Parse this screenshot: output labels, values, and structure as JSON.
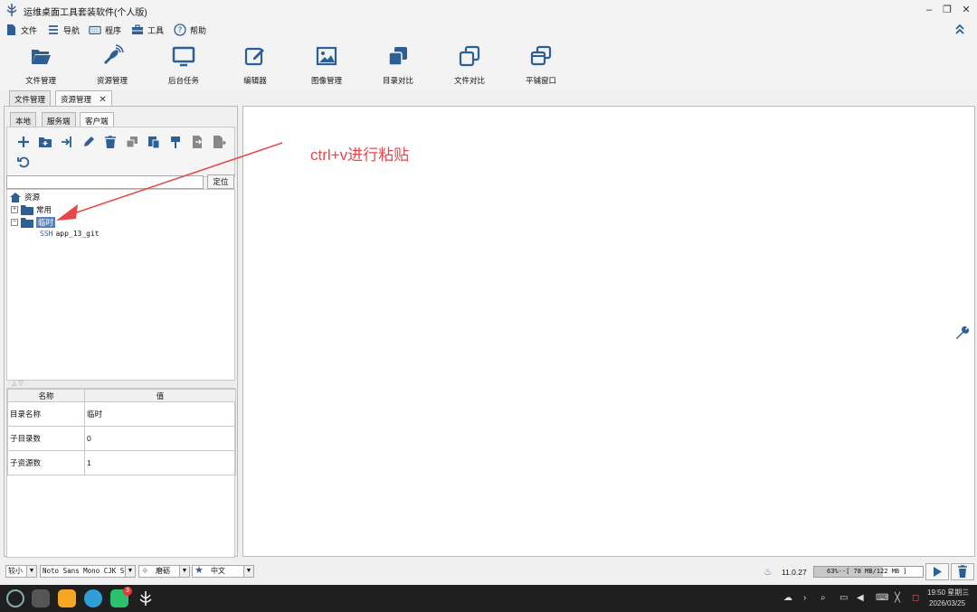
{
  "window": {
    "title": "运维桌面工具套装软件(个人版)"
  },
  "menu": [
    {
      "label": "文件",
      "icon": "file-icon"
    },
    {
      "label": "导航",
      "icon": "menu-icon"
    },
    {
      "label": "程序",
      "icon": "keyboard-icon"
    },
    {
      "label": "工具",
      "icon": "toolbox-icon"
    },
    {
      "label": "帮助",
      "icon": "help-icon"
    }
  ],
  "toolbar": [
    {
      "label": "文件管理",
      "icon": "folder-open-icon"
    },
    {
      "label": "资源管理",
      "icon": "satellite-icon"
    },
    {
      "label": "后台任务",
      "icon": "monitor-icon"
    },
    {
      "label": "编辑器",
      "icon": "edit-icon"
    },
    {
      "label": "图像管理",
      "icon": "image-icon"
    },
    {
      "label": "目录对比",
      "icon": "stack-icon"
    },
    {
      "label": "文件对比",
      "icon": "copy-icon"
    },
    {
      "label": "平铺窗口",
      "icon": "windows-icon"
    }
  ],
  "tabs": [
    {
      "label": "文件管理"
    },
    {
      "label": "资源管理",
      "close": "✕"
    }
  ],
  "subtabs": [
    {
      "label": "本地"
    },
    {
      "label": "服务端"
    },
    {
      "label": "客户端"
    }
  ],
  "locate": {
    "value": "",
    "button": "定位"
  },
  "tree": {
    "root": "资源",
    "nodes": [
      {
        "label": "常用",
        "expander": "+"
      },
      {
        "label": "临时",
        "expander": "−"
      }
    ],
    "leaf": {
      "badge": "SSH",
      "label": "app_13_git"
    }
  },
  "properties": {
    "headers": [
      "名称",
      "值"
    ],
    "rows": [
      {
        "name": "目录名称",
        "value": "临时"
      },
      {
        "name": "子目录数",
        "value": "0"
      },
      {
        "name": "子资源数",
        "value": "1"
      }
    ]
  },
  "annotation": {
    "text": "ctrl+v进行粘贴",
    "color": "#e8474a"
  },
  "status": {
    "size_select": "较小",
    "font_select": "Noto Sans Mono CJK SC",
    "theme_select": "磨砺",
    "lang_select": "中文",
    "java_version": "11.0.27",
    "memory": "63%--[ 78 MB/122 MB ]"
  },
  "taskbar": {
    "time": "19:50 星期三",
    "date": "2026/03/25",
    "badge_count": "3"
  },
  "colors": {
    "accent": "#2b5f96",
    "annotation": "#e8474a"
  }
}
